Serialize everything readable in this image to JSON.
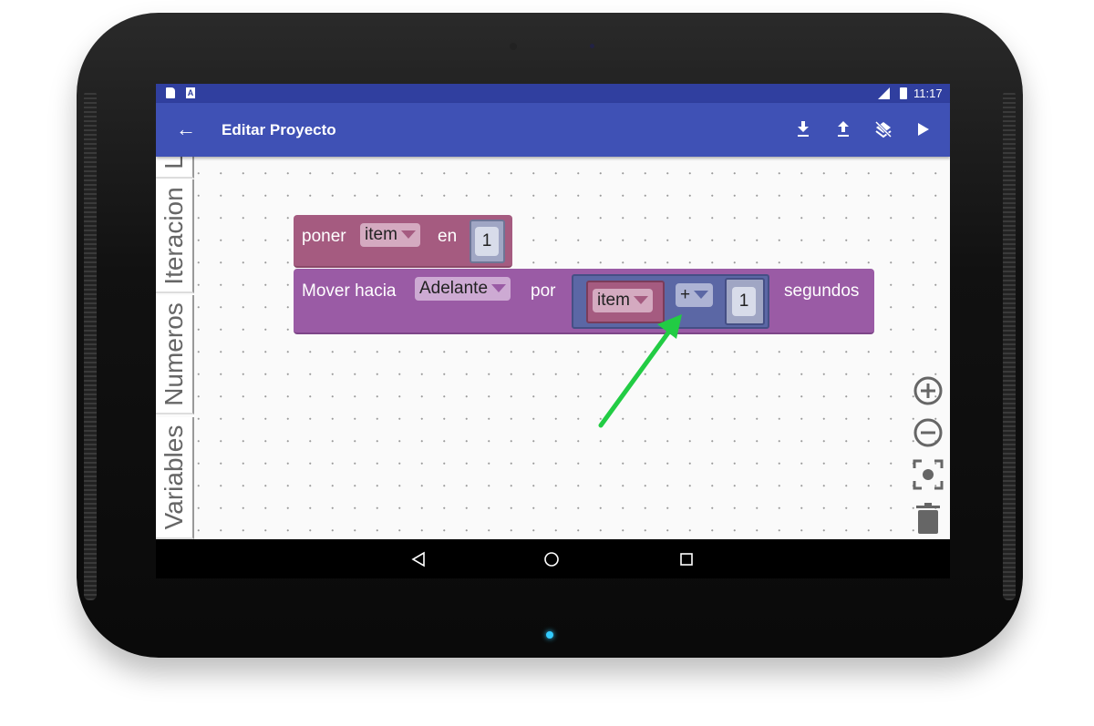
{
  "status_bar": {
    "time": "11:17",
    "icons": [
      "sd-card-icon",
      "a-notification-icon",
      "lte-signal-icon",
      "battery-icon"
    ]
  },
  "app_bar": {
    "title": "Editar Proyecto",
    "back_icon": "arrow-back-icon",
    "actions": [
      "download-icon",
      "upload-icon",
      "clear-layers-icon",
      "play-icon"
    ]
  },
  "toolbox": {
    "tabs": [
      {
        "label": "L"
      },
      {
        "label": "Iteracion"
      },
      {
        "label": "Numeros"
      },
      {
        "label": "Variables"
      }
    ]
  },
  "blocks": {
    "set": {
      "label": "poner",
      "variable": "item",
      "label2": "en",
      "value": "1",
      "color": "#a55b80"
    },
    "move": {
      "label": "Mover hacia",
      "direction": "Adelante",
      "label2": "por",
      "label3": "segundos",
      "color": "#9a5ba5",
      "math": {
        "variable": "item",
        "operator": "+",
        "value": "1",
        "color": "#5b67a5"
      }
    }
  },
  "canvas_controls": [
    "zoom-in-icon",
    "zoom-out-icon",
    "recenter-icon",
    "trash-icon"
  ],
  "annotation_color": "#22cc44",
  "nav_bar": [
    "back-icon",
    "home-icon",
    "recents-icon"
  ]
}
